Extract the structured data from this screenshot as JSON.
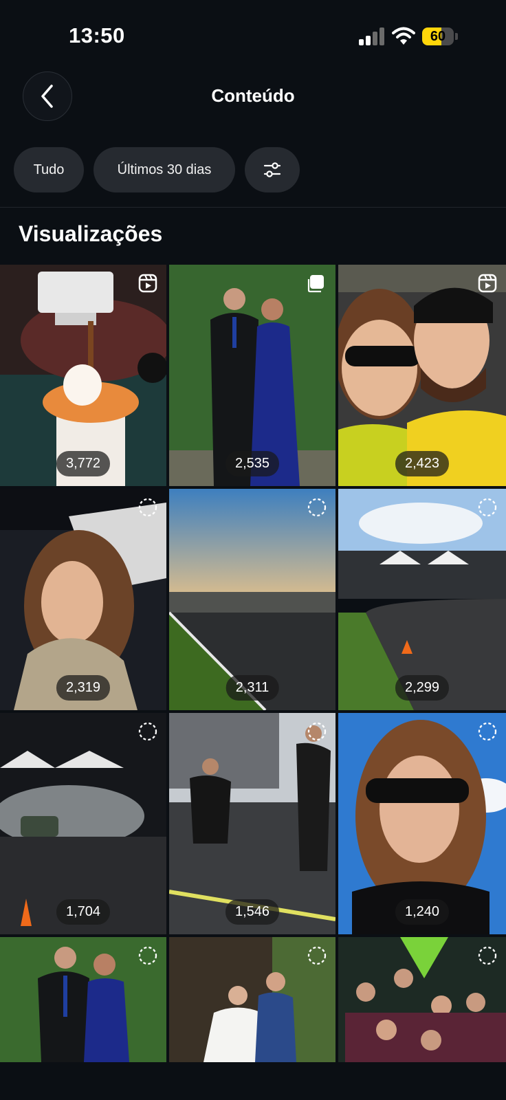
{
  "status_bar": {
    "time": "13:50",
    "battery": "60"
  },
  "header": {
    "title": "Conteúdo"
  },
  "filters": {
    "all_label": "Tudo",
    "period_label": "Últimos 30 dias",
    "settings_icon": "sliders-icon"
  },
  "section": {
    "title": "Visualizações"
  },
  "posts": [
    {
      "views": "3,772",
      "type": "reel-icon"
    },
    {
      "views": "2,535",
      "type": "carousel-icon"
    },
    {
      "views": "2,423",
      "type": "reel-icon"
    },
    {
      "views": "2,319",
      "type": "story-icon"
    },
    {
      "views": "2,311",
      "type": "story-icon"
    },
    {
      "views": "2,299",
      "type": "story-icon"
    },
    {
      "views": "1,704",
      "type": "story-icon"
    },
    {
      "views": "1,546",
      "type": "story-icon"
    },
    {
      "views": "1,240",
      "type": "story-icon"
    },
    {
      "views": "",
      "type": "story-icon"
    },
    {
      "views": "",
      "type": "story-icon"
    },
    {
      "views": "",
      "type": "story-icon"
    }
  ],
  "colors": {
    "background": "#0b0f14",
    "chip": "#262a30",
    "battery": "#ffd60a"
  }
}
